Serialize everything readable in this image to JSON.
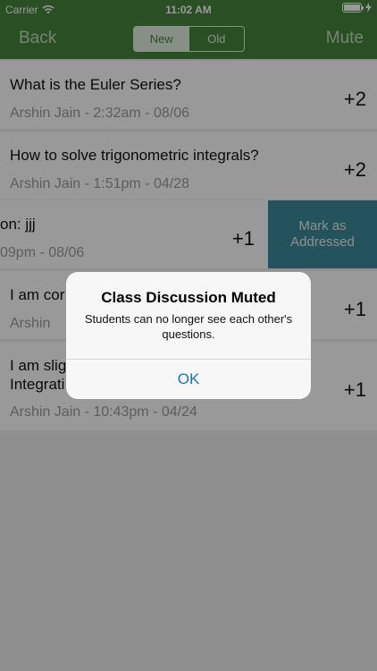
{
  "status_bar": {
    "carrier": "Carrier",
    "time": "11:02 AM"
  },
  "nav": {
    "back": "Back",
    "segments": [
      "New",
      "Old"
    ],
    "mute": "Mute"
  },
  "questions": [
    {
      "text": "What is the Euler Series?",
      "meta": "Arshin Jain - 2:32am - 08/06",
      "score": "+2"
    },
    {
      "text": "How to solve trigonometric integrals?",
      "meta": "Arshin Jain - 1:51pm - 04/28",
      "score": "+2"
    },
    {
      "text": "on: jjj",
      "meta": "09pm - 08/06",
      "score": "+1",
      "action_line1": "Mark as",
      "action_line2": "Addressed"
    },
    {
      "text": "I am cor",
      "meta": "Arshin",
      "score": "+1"
    },
    {
      "text_line1": "I am slig",
      "text_line2": "Integrati",
      "meta": "Arshin Jain - 10:43pm - 04/24",
      "score": "+1"
    }
  ],
  "alert": {
    "title": "Class Discussion Muted",
    "message": "Students can no longer see each other's questions.",
    "button": "OK"
  }
}
